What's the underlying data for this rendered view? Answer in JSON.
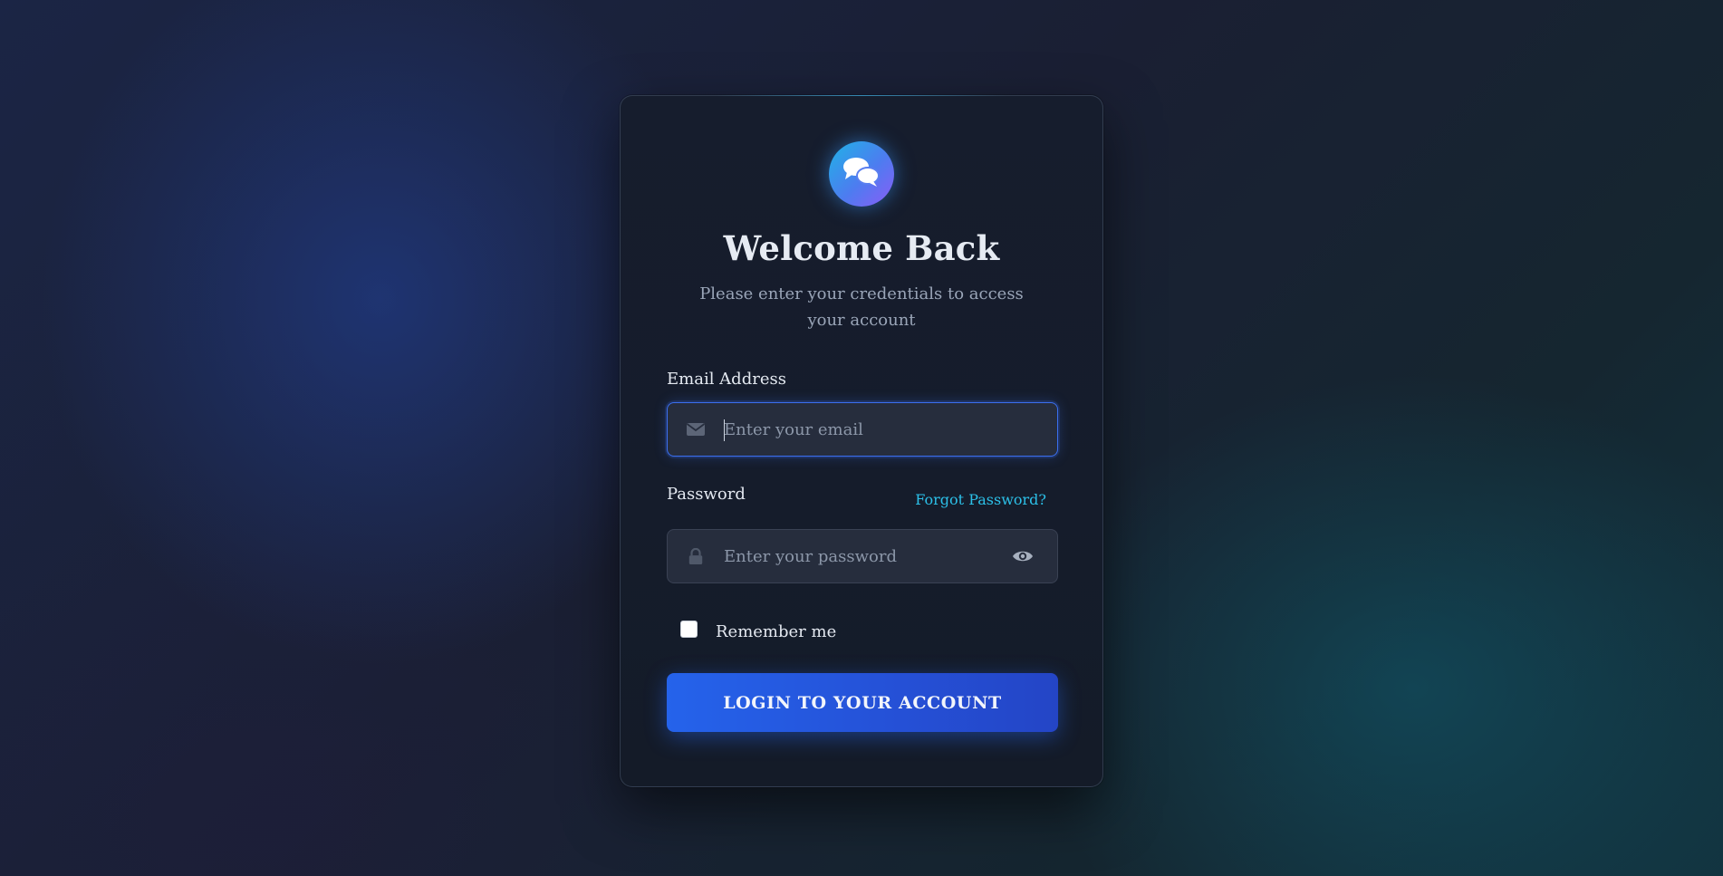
{
  "colors": {
    "accent": "#2563eb",
    "link": "#2cc0e8",
    "card_bg": "#151c2b",
    "input_bg": "#262d3d",
    "focus_border": "#3b6ff0"
  },
  "header": {
    "logo_icon": "chat-bubbles-icon",
    "title": "Welcome Back",
    "subtitle": "Please enter your credentials to access your account"
  },
  "form": {
    "email": {
      "label": "Email Address",
      "placeholder": "Enter your email",
      "value": "",
      "icon": "envelope-icon",
      "focused": true
    },
    "password": {
      "label": "Password",
      "placeholder": "Enter your password",
      "value": "",
      "icon": "lock-icon",
      "toggle_icon": "eye-icon"
    },
    "forgot_password": "Forgot Password?",
    "remember_me": {
      "label": "Remember me",
      "checked": false
    },
    "submit_label": "LOGIN TO YOUR ACCOUNT"
  }
}
